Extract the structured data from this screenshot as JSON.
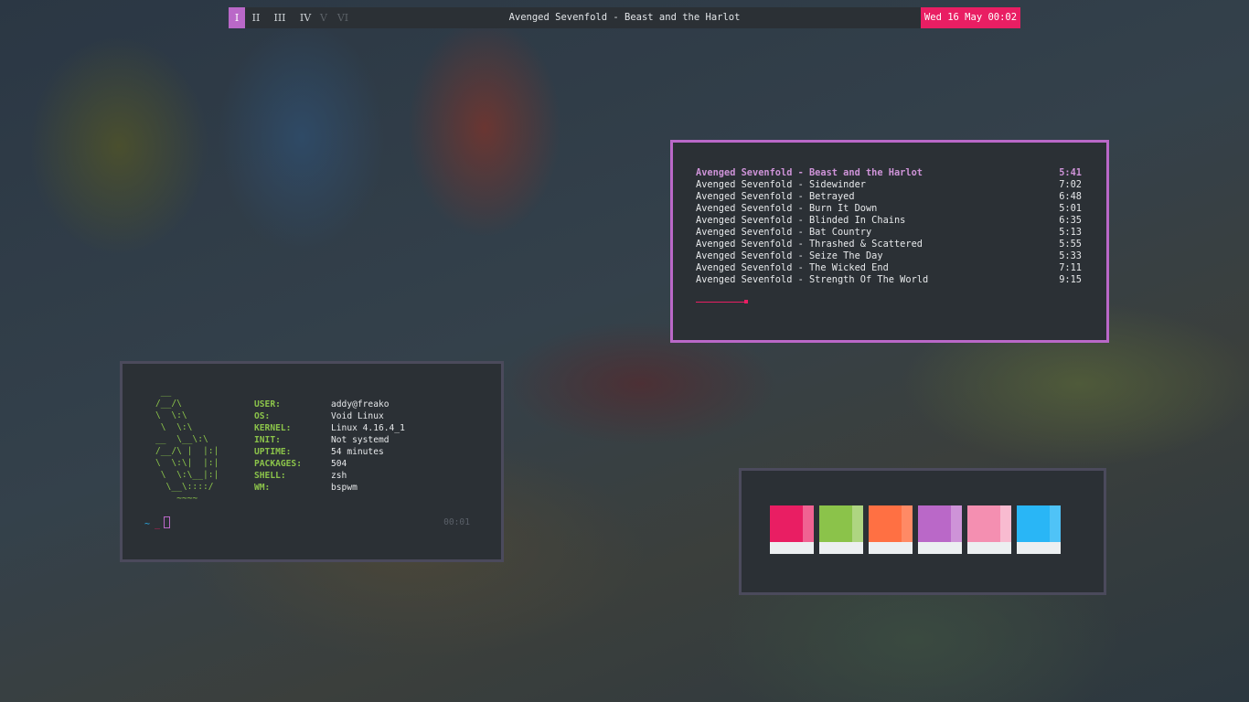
{
  "bar": {
    "workspaces": [
      {
        "label": "I",
        "state": "active"
      },
      {
        "label": "II",
        "state": "occupied"
      },
      {
        "label": "III",
        "state": "occupied"
      },
      {
        "label": "IV",
        "state": "occupied"
      },
      {
        "label": "V",
        "state": "empty"
      },
      {
        "label": "VI",
        "state": "empty"
      }
    ],
    "title": "Avenged Sevenfold - Beast and the Harlot",
    "clock": "Wed 16 May 00:02",
    "colors": {
      "active_workspace": "#ba68c8",
      "clock_bg": "#e91e63"
    }
  },
  "player": {
    "tracks": [
      {
        "title": "Avenged Sevenfold - Beast and the Harlot",
        "duration": "5:41",
        "current": true
      },
      {
        "title": "Avenged Sevenfold - Sidewinder",
        "duration": "7:02"
      },
      {
        "title": "Avenged Sevenfold - Betrayed",
        "duration": "6:48"
      },
      {
        "title": "Avenged Sevenfold - Burn It Down",
        "duration": "5:01"
      },
      {
        "title": "Avenged Sevenfold - Blinded In Chains",
        "duration": "6:35"
      },
      {
        "title": "Avenged Sevenfold - Bat Country",
        "duration": "5:13"
      },
      {
        "title": "Avenged Sevenfold - Thrashed & Scattered",
        "duration": "5:55"
      },
      {
        "title": "Avenged Sevenfold - Seize The Day",
        "duration": "5:33"
      },
      {
        "title": "Avenged Sevenfold - The Wicked End",
        "duration": "7:11"
      },
      {
        "title": "Avenged Sevenfold - Strength Of The World",
        "duration": "9:15"
      }
    ],
    "progress_fraction": 0.13,
    "colors": {
      "border": "#ba68c8",
      "current_track": "#ce93d8",
      "progress": "#e91e63"
    }
  },
  "terminal": {
    "ascii_logo": " __\n/__/\\\n\\  \\:\\\n \\  \\:\\\n__  \\__\\:\\\n/__/\\ |  |:|\n\\  \\:\\|  |:|\n \\  \\:\\__|:|\n  \\__\\::::/\n    ~~~~",
    "info": [
      {
        "key": "USER:",
        "value": "addy@freako"
      },
      {
        "key": "OS:",
        "value": "Void Linux"
      },
      {
        "key": "KERNEL:",
        "value": "Linux 4.16.4_1"
      },
      {
        "key": "INIT:",
        "value": "Not systemd"
      },
      {
        "key": "UPTIME:",
        "value": "54 minutes"
      },
      {
        "key": "PACKAGES:",
        "value": "504"
      },
      {
        "key": "SHELL:",
        "value": "zsh"
      },
      {
        "key": "WM:",
        "value": "bspwm"
      }
    ],
    "prompt": {
      "tilde": "~",
      "arrow": "_"
    },
    "time": "00:01",
    "colors": {
      "accent": "#8bc34a",
      "tilde": "#29b6f6",
      "arrow": "#e91e63"
    }
  },
  "palette": {
    "swatches": [
      {
        "color": "#e91e63",
        "light": "#f06292"
      },
      {
        "color": "#8bc34a",
        "light": "#aed581"
      },
      {
        "color": "#ff7043",
        "light": "#ff8a65"
      },
      {
        "color": "#ba68c8",
        "light": "#ce93d8"
      },
      {
        "color": "#f48fb1",
        "light": "#f8bbd0"
      },
      {
        "color": "#29b6f6",
        "light": "#4fc3f7"
      }
    ]
  }
}
